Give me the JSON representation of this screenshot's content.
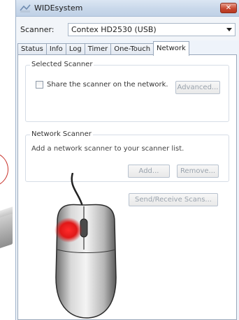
{
  "window": {
    "title": "WIDEsystem",
    "close_label": "✕"
  },
  "scanner": {
    "label": "Scanner:",
    "selected": "Contex HD2530 (USB)"
  },
  "tabs": [
    {
      "label": "Status"
    },
    {
      "label": "Info"
    },
    {
      "label": "Log"
    },
    {
      "label": "Timer"
    },
    {
      "label": "One-Touch"
    },
    {
      "label": "Network",
      "active": true
    }
  ],
  "selected_scanner": {
    "title": "Selected Scanner",
    "share_label": "Share the scanner on the network.",
    "share_checked": false,
    "advanced_label": "Advanced..."
  },
  "network_scanner": {
    "title": "Network Scanner",
    "hint": "Add a network scanner to your scanner list.",
    "add_label": "Add...",
    "remove_label": "Remove...",
    "send_receive_label": "Send/Receive Scans..."
  },
  "colors": {
    "titlebar": "#c9d8ea",
    "close": "#c5442c",
    "mouse_highlight": "#e01818"
  },
  "icons": [
    "app-icon",
    "dropdown-arrow-icon",
    "mouse-icon"
  ]
}
